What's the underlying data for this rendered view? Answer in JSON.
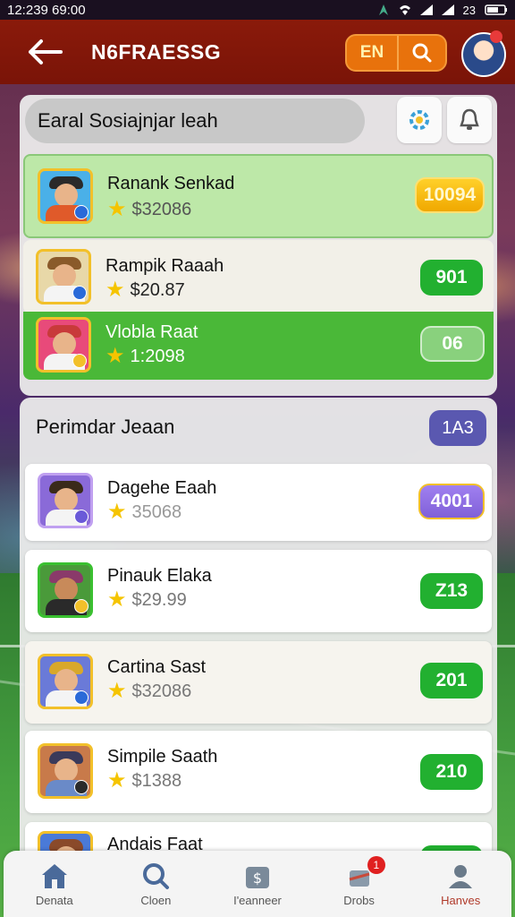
{
  "status_bar": {
    "time": "12:239 69:00",
    "battery": "23"
  },
  "header": {
    "title": "N6FRAESSG",
    "lang": "EN"
  },
  "section1": {
    "title": "Earal Sosiajnjar leah",
    "rows": [
      {
        "name": "Ranank Senkad",
        "value": "$32086",
        "pill": "10094"
      },
      {
        "name": "Rampik Raaah",
        "value": "$20.87",
        "pill": "901"
      },
      {
        "name": "Vlobla Raat",
        "value": "1:2098",
        "pill": "06"
      }
    ]
  },
  "section2": {
    "title": "Perimdar Jeaan",
    "count": "1A3",
    "rows": [
      {
        "name": "Dagehe Eaah",
        "value": "35068",
        "pill": "4001"
      },
      {
        "name": "Pinauk Elaka",
        "value": "$29.99",
        "pill": "Z13"
      },
      {
        "name": "Cartina Sast",
        "value": "$32086",
        "pill": "201"
      },
      {
        "name": "Simpile Saath",
        "value": "$1388",
        "pill": "210"
      },
      {
        "name": "Andais Faat",
        "value": "",
        "pill": ""
      }
    ]
  },
  "nav": {
    "items": [
      {
        "label": "Denata"
      },
      {
        "label": "Cloen"
      },
      {
        "label": "I'eanneer"
      },
      {
        "label": "Drobs",
        "badge": "1"
      },
      {
        "label": "Hanves"
      }
    ]
  },
  "colors": {
    "header": "#8a1a0a",
    "accent_orange": "#e8720c",
    "green": "#22b030",
    "purple": "#5a58b0",
    "gold": "#f5c400"
  }
}
